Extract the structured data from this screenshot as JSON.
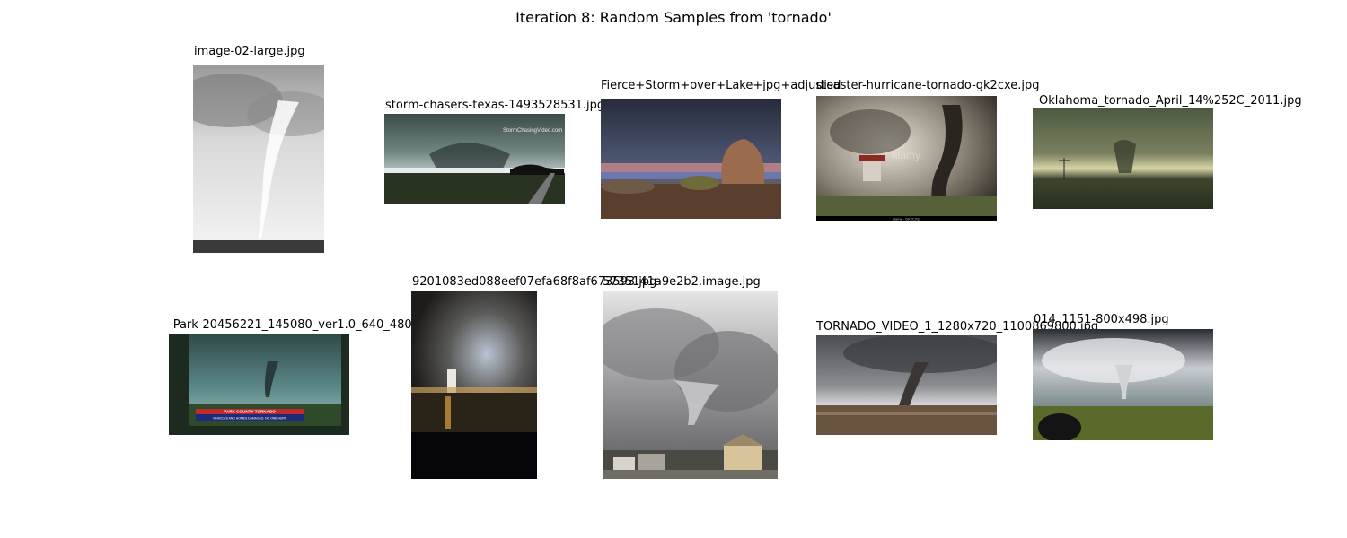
{
  "figure": {
    "title": "Iteration 8: Random Samples from 'tornado'"
  },
  "samples": [
    {
      "caption": "image-02-large.jpg"
    },
    {
      "caption": "storm-chasers-texas-1493528531.jpg",
      "watermark": "StormChasingVideo.com"
    },
    {
      "caption": "Fierce+Storm+over+Lake+jpg+adjusted"
    },
    {
      "caption": "disaster-hurricane-tornado-gk2cxe.jpg",
      "watermark": "alamy",
      "footer": "alamy - GK2CXE"
    },
    {
      "caption": "Oklahoma_tornado_April_14%252C_2011.jpg"
    },
    {
      "caption": "-Park-20456221_145080_ver1.0_640_480",
      "banner_title": "PARK COUNTY TORNADO",
      "banner_sub": "VEHICLES AND HOMES DAMAGED, NO ONE HURT"
    },
    {
      "caption": "9201083ed088eef07efa68f8af673593.jpg"
    },
    {
      "caption": "5735141a9e2b2.image.jpg"
    },
    {
      "caption": "TORNADO_VIDEO_1_1280x720_1100869800.jpg"
    },
    {
      "caption": "014_1151-800x498.jpg"
    }
  ]
}
